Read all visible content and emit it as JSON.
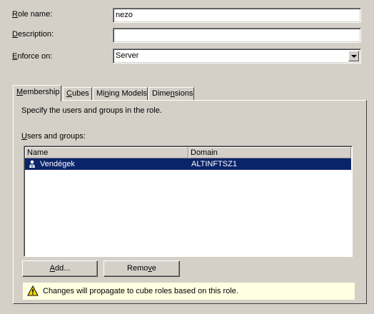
{
  "form": {
    "role_name_label_pre": "",
    "role_name_label_key": "R",
    "role_name_label_post": "ole name:",
    "role_name_value": "nezo",
    "description_label_key": "D",
    "description_label_post": "escription:",
    "description_value": "",
    "enforce_label_key": "E",
    "enforce_label_post": "nforce on:",
    "enforce_value": "Server"
  },
  "tabs": [
    {
      "pre": "",
      "key": "M",
      "post": "embership"
    },
    {
      "pre": "",
      "key": "C",
      "post": "ubes"
    },
    {
      "pre": "Mi",
      "key": "n",
      "post": "ing Models"
    },
    {
      "pre": "Dime",
      "key": "n",
      "post": "sions"
    }
  ],
  "membership": {
    "instructions": "Specify the users and groups in the role.",
    "list_label_pre": "",
    "list_label_key": "U",
    "list_label_post": "sers and groups:",
    "columns": [
      "Name",
      "Domain"
    ],
    "rows": [
      {
        "name": "Vendégek",
        "domain": "ALTINFTSZ1",
        "icon": "user-group-icon",
        "selected": true
      }
    ],
    "add_pre": "",
    "add_key": "A",
    "add_post": "dd...",
    "remove_pre": "Remo",
    "remove_key": "v",
    "remove_post": "e"
  },
  "info": {
    "icon": "warning-icon",
    "text": "Changes will propagate to cube roles based on this role."
  },
  "colors": {
    "dialog_bg": "#d4d0c8",
    "selection_bg": "#0a246a",
    "info_bg": "#ffffe1"
  }
}
